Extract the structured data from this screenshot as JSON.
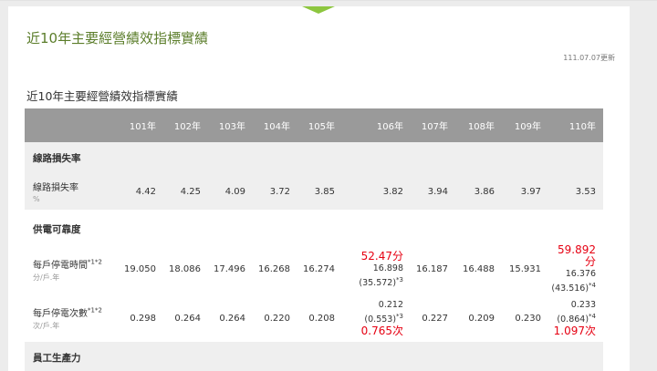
{
  "page_title": "近10年主要經營績效指標實績",
  "update_date": "111.07.07更新",
  "section_title": "近10年主要經營績效指標實績",
  "table": {
    "years": [
      "101年",
      "102年",
      "103年",
      "104年",
      "105年",
      "106年",
      "107年",
      "108年",
      "109年",
      "110年"
    ],
    "groups": [
      {
        "name": "線路損失率",
        "rows": [
          {
            "label": "線路損失率",
            "label_sup": "",
            "unit": "%",
            "values": [
              "4.42",
              "4.25",
              "4.09",
              "3.72",
              "3.85",
              "3.82",
              "3.94",
              "3.86",
              "3.97",
              "3.53"
            ]
          }
        ]
      },
      {
        "name": "供電可靠度",
        "rows": [
          {
            "label": "每戶停電時間",
            "label_sup": "*1*2",
            "unit": "分/戶.年",
            "values": [
              "19.050",
              "18.086",
              "17.496",
              "16.268",
              "16.274",
              "16.898",
              "16.187",
              "16.488",
              "15.931",
              "16.376"
            ],
            "notes": {
              "5": {
                "highlight": "52.47分",
                "sub": "(35.572)",
                "sub_sup": "*3"
              },
              "9": {
                "highlight": "59.892分",
                "sub": "(43.516)",
                "sub_sup": "*4"
              }
            }
          },
          {
            "label": "每戶停電次數",
            "label_sup": "*1*2",
            "unit": "次/戶.年",
            "values": [
              "0.298",
              "0.264",
              "0.264",
              "0.220",
              "0.208",
              "0.212",
              "0.227",
              "0.209",
              "0.230",
              "0.233"
            ],
            "notes": {
              "5": {
                "highlight": "0.765次",
                "sub": "(0.553)",
                "sub_sup": "*3"
              },
              "9": {
                "highlight": "1.097次",
                "sub": "(0.864)",
                "sub_sup": "*4"
              }
            }
          }
        ]
      },
      {
        "name": "員工生產力",
        "rows": []
      }
    ]
  },
  "colors": {
    "header_bg": "#9a9a9a",
    "title_green": "#5b7d2a",
    "accent_green": "#8dc63f",
    "highlight_red": "#e60012",
    "row_grey": "#efefef"
  }
}
